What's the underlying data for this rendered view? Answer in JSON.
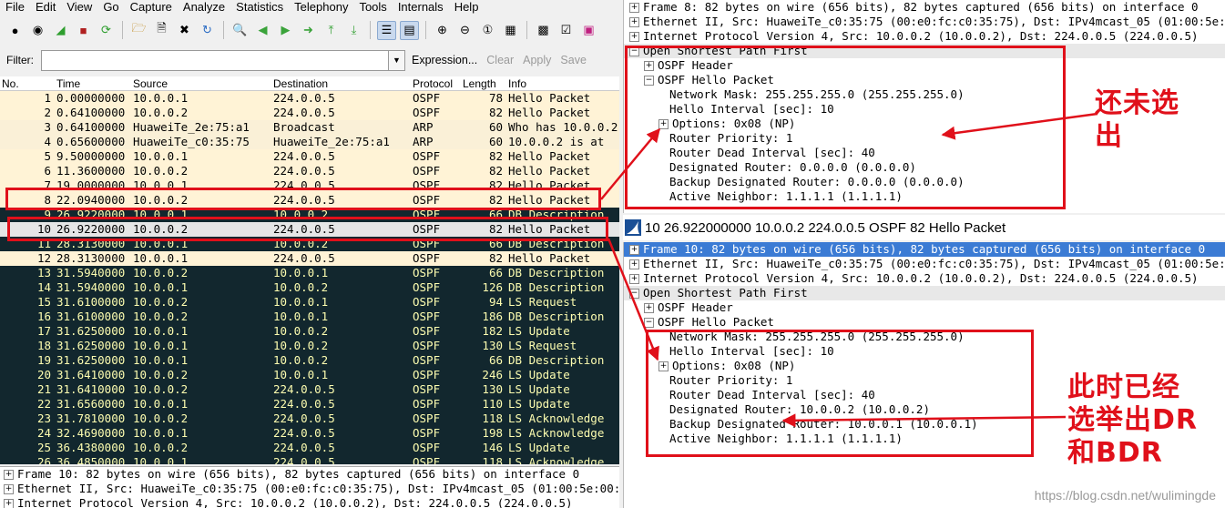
{
  "menu": [
    "File",
    "Edit",
    "View",
    "Go",
    "Capture",
    "Analyze",
    "Statistics",
    "Telephony",
    "Tools",
    "Internals",
    "Help"
  ],
  "toolbar_icons": [
    "interface-list-icon",
    "capture-options-icon",
    "start-capture-icon",
    "stop-capture-icon",
    "restart-capture-icon",
    "open-file-icon",
    "save-file-icon",
    "close-file-icon",
    "reload-icon",
    "find-packet-icon",
    "go-back-icon",
    "go-forward-icon",
    "go-to-packet-icon",
    "go-first-icon",
    "go-last-icon",
    "colorize-icon",
    "autoscroll-icon",
    "zoom-in-icon",
    "zoom-out-icon",
    "normal-size-icon",
    "resize-columns-icon",
    "capture-filters-icon",
    "display-filters-icon",
    "coloring-rules-icon"
  ],
  "filter": {
    "label": "Filter:",
    "value": "",
    "expression": "Expression...",
    "clear": "Clear",
    "apply": "Apply",
    "save": "Save"
  },
  "columns": {
    "no": "No.",
    "time": "Time",
    "source": "Source",
    "destination": "Destination",
    "protocol": "Protocol",
    "length": "Length",
    "info": "Info"
  },
  "packets": [
    {
      "no": "1",
      "time": "0.00000000",
      "src": "10.0.0.1",
      "dst": "224.0.0.5",
      "proto": "OSPF",
      "len": "78",
      "info": "Hello Packet",
      "bg": "#fff3d6",
      "fg": "#000000"
    },
    {
      "no": "2",
      "time": "0.64100000",
      "src": "10.0.0.2",
      "dst": "224.0.0.5",
      "proto": "OSPF",
      "len": "82",
      "info": "Hello Packet",
      "bg": "#fff3d6",
      "fg": "#000000"
    },
    {
      "no": "3",
      "time": "0.64100000",
      "src": "HuaweiTe_2e:75:a1",
      "dst": "Broadcast",
      "proto": "ARP",
      "len": "60",
      "info": "Who has 10.0.0.2",
      "bg": "#faf0d7",
      "fg": "#000000"
    },
    {
      "no": "4",
      "time": "0.65600000",
      "src": "HuaweiTe_c0:35:75",
      "dst": "HuaweiTe_2e:75:a1",
      "proto": "ARP",
      "len": "60",
      "info": "10.0.0.2 is at",
      "bg": "#faf0d7",
      "fg": "#000000"
    },
    {
      "no": "5",
      "time": "9.50000000",
      "src": "10.0.0.1",
      "dst": "224.0.0.5",
      "proto": "OSPF",
      "len": "82",
      "info": "Hello Packet",
      "bg": "#fff3d6",
      "fg": "#000000"
    },
    {
      "no": "6",
      "time": "11.3600000",
      "src": "10.0.0.2",
      "dst": "224.0.0.5",
      "proto": "OSPF",
      "len": "82",
      "info": "Hello Packet",
      "bg": "#fff3d6",
      "fg": "#000000"
    },
    {
      "no": "7",
      "time": "19.0000000",
      "src": "10.0.0.1",
      "dst": "224.0.0.5",
      "proto": "OSPF",
      "len": "82",
      "info": "Hello Packet",
      "bg": "#fff3d6",
      "fg": "#000000"
    },
    {
      "no": "8",
      "time": "22.0940000",
      "src": "10.0.0.2",
      "dst": "224.0.0.5",
      "proto": "OSPF",
      "len": "82",
      "info": "Hello Packet",
      "bg": "#fff3d6",
      "fg": "#000000"
    },
    {
      "no": "9",
      "time": "26.9220000",
      "src": "10.0.0.1",
      "dst": "10.0.0.2",
      "proto": "OSPF",
      "len": "66",
      "info": "DB Description",
      "bg": "#12272e",
      "fg": "#fdfdb0"
    },
    {
      "no": "10",
      "time": "26.9220000",
      "src": "10.0.0.2",
      "dst": "224.0.0.5",
      "proto": "OSPF",
      "len": "82",
      "info": "Hello Packet",
      "bg": "#e6e6e6",
      "fg": "#000000"
    },
    {
      "no": "11",
      "time": "28.3130000",
      "src": "10.0.0.1",
      "dst": "10.0.0.2",
      "proto": "OSPF",
      "len": "66",
      "info": "DB Description",
      "bg": "#12272e",
      "fg": "#fdfdb0"
    },
    {
      "no": "12",
      "time": "28.3130000",
      "src": "10.0.0.1",
      "dst": "224.0.0.5",
      "proto": "OSPF",
      "len": "82",
      "info": "Hello Packet",
      "bg": "#fff3d6",
      "fg": "#000000"
    },
    {
      "no": "13",
      "time": "31.5940000",
      "src": "10.0.0.2",
      "dst": "10.0.0.1",
      "proto": "OSPF",
      "len": "66",
      "info": "DB Description",
      "bg": "#12272e",
      "fg": "#fdfdb0"
    },
    {
      "no": "14",
      "time": "31.5940000",
      "src": "10.0.0.1",
      "dst": "10.0.0.2",
      "proto": "OSPF",
      "len": "126",
      "info": "DB Description",
      "bg": "#12272e",
      "fg": "#fdfdb0"
    },
    {
      "no": "15",
      "time": "31.6100000",
      "src": "10.0.0.2",
      "dst": "10.0.0.1",
      "proto": "OSPF",
      "len": "94",
      "info": "LS Request",
      "bg": "#12272e",
      "fg": "#fdfdb0"
    },
    {
      "no": "16",
      "time": "31.6100000",
      "src": "10.0.0.2",
      "dst": "10.0.0.1",
      "proto": "OSPF",
      "len": "186",
      "info": "DB Description",
      "bg": "#12272e",
      "fg": "#fdfdb0"
    },
    {
      "no": "17",
      "time": "31.6250000",
      "src": "10.0.0.1",
      "dst": "10.0.0.2",
      "proto": "OSPF",
      "len": "182",
      "info": "LS Update",
      "bg": "#12272e",
      "fg": "#fdfdb0"
    },
    {
      "no": "18",
      "time": "31.6250000",
      "src": "10.0.0.1",
      "dst": "10.0.0.2",
      "proto": "OSPF",
      "len": "130",
      "info": "LS Request",
      "bg": "#12272e",
      "fg": "#fdfdb0"
    },
    {
      "no": "19",
      "time": "31.6250000",
      "src": "10.0.0.1",
      "dst": "10.0.0.2",
      "proto": "OSPF",
      "len": "66",
      "info": "DB Description",
      "bg": "#12272e",
      "fg": "#fdfdb0"
    },
    {
      "no": "20",
      "time": "31.6410000",
      "src": "10.0.0.2",
      "dst": "10.0.0.1",
      "proto": "OSPF",
      "len": "246",
      "info": "LS Update",
      "bg": "#12272e",
      "fg": "#fdfdb0"
    },
    {
      "no": "21",
      "time": "31.6410000",
      "src": "10.0.0.2",
      "dst": "224.0.0.5",
      "proto": "OSPF",
      "len": "130",
      "info": "LS Update",
      "bg": "#12272e",
      "fg": "#fdfdb0"
    },
    {
      "no": "22",
      "time": "31.6560000",
      "src": "10.0.0.1",
      "dst": "224.0.0.5",
      "proto": "OSPF",
      "len": "110",
      "info": "LS Update",
      "bg": "#12272e",
      "fg": "#fdfdb0"
    },
    {
      "no": "23",
      "time": "31.7810000",
      "src": "10.0.0.2",
      "dst": "224.0.0.5",
      "proto": "OSPF",
      "len": "118",
      "info": "LS Acknowledge",
      "bg": "#12272e",
      "fg": "#fdfdb0"
    },
    {
      "no": "24",
      "time": "32.4690000",
      "src": "10.0.0.1",
      "dst": "224.0.0.5",
      "proto": "OSPF",
      "len": "198",
      "info": "LS Acknowledge",
      "bg": "#12272e",
      "fg": "#fdfdb0"
    },
    {
      "no": "25",
      "time": "36.4380000",
      "src": "10.0.0.2",
      "dst": "224.0.0.5",
      "proto": "OSPF",
      "len": "146",
      "info": "LS Update",
      "bg": "#12272e",
      "fg": "#fdfdb0"
    },
    {
      "no": "26",
      "time": "36.4850000",
      "src": "10.0.0.1",
      "dst": "224.0.0.5",
      "proto": "OSPF",
      "len": "118",
      "info": "LS Acknowledge",
      "bg": "#12272e",
      "fg": "#fdfdb0"
    }
  ],
  "left_detail": [
    "Frame 10: 82 bytes on wire (656 bits), 82 bytes captured (656 bits) on interface 0",
    "Ethernet II, Src: HuaweiTe_c0:35:75 (00:e0:fc:c0:35:75), Dst: IPv4mcast_05 (01:00:5e:00:00:05)",
    "Internet Protocol Version 4, Src: 10.0.0.2 (10.0.0.2), Dst: 224.0.0.5 (224.0.0.5)"
  ],
  "pane_top": {
    "frame": "Frame 8: 82 bytes on wire (656 bits), 82 bytes captured (656 bits) on interface 0",
    "ethernet": "Ethernet II, Src: HuaweiTe_c0:35:75 (00:e0:fc:c0:35:75), Dst: IPv4mcast_05 (01:00:5e:00:00:05)",
    "ip": "Internet Protocol Version 4, Src: 10.0.0.2 (10.0.0.2), Dst: 224.0.0.5 (224.0.0.5)",
    "ospf": "Open Shortest Path First",
    "ospf_header": "OSPF Header",
    "hello": "OSPF Hello Packet",
    "fields": [
      {
        "expandable": false,
        "text": "Network Mask: 255.255.255.0 (255.255.255.0)"
      },
      {
        "expandable": false,
        "text": "Hello Interval [sec]: 10"
      },
      {
        "expandable": true,
        "text": "Options: 0x08 (NP)"
      },
      {
        "expandable": false,
        "text": "Router Priority: 1"
      },
      {
        "expandable": false,
        "text": "Router Dead Interval [sec]: 40"
      },
      {
        "expandable": false,
        "text": "Designated Router: 0.0.0.0 (0.0.0.0)"
      },
      {
        "expandable": false,
        "text": "Backup Designated Router: 0.0.0.0 (0.0.0.0)"
      },
      {
        "expandable": false,
        "text": "Active Neighbor: 1.1.1.1 (1.1.1.1)"
      }
    ]
  },
  "window_title": "10 26.922000000 10.0.0.2 224.0.0.5 OSPF 82 Hello Packet",
  "pane_bottom": {
    "frame": "Frame 10: 82 bytes on wire (656 bits), 82 bytes captured (656 bits) on interface 0",
    "ethernet": "Ethernet II, Src: HuaweiTe_c0:35:75 (00:e0:fc:c0:35:75), Dst: IPv4mcast_05 (01:00:5e:00:00:05)",
    "ip": "Internet Protocol Version 4, Src: 10.0.0.2 (10.0.0.2), Dst: 224.0.0.5 (224.0.0.5)",
    "ospf": "Open Shortest Path First",
    "ospf_header": "OSPF Header",
    "hello": "OSPF Hello Packet",
    "fields": [
      {
        "expandable": false,
        "text": "Network Mask: 255.255.255.0 (255.255.255.0)"
      },
      {
        "expandable": false,
        "text": "Hello Interval [sec]: 10"
      },
      {
        "expandable": true,
        "text": "Options: 0x08 (NP)"
      },
      {
        "expandable": false,
        "text": "Router Priority: 1"
      },
      {
        "expandable": false,
        "text": "Router Dead Interval [sec]: 40"
      },
      {
        "expandable": false,
        "text": "Designated Router: 10.0.0.2 (10.0.0.2)"
      },
      {
        "expandable": false,
        "text": "Backup Designated Router: 10.0.0.1 (10.0.0.1)"
      },
      {
        "expandable": false,
        "text": "Active Neighbor: 1.1.1.1 (1.1.1.1)"
      }
    ]
  },
  "annotations": {
    "top_note_line1": "还未选",
    "top_note_line2": "出",
    "bottom_note_line1": "此时已经",
    "bottom_note_line2": "选举出DR",
    "bottom_note_line3": "和BDR",
    "color": "#e0101a"
  },
  "watermark": "https://blog.csdn.net/wulimingde"
}
